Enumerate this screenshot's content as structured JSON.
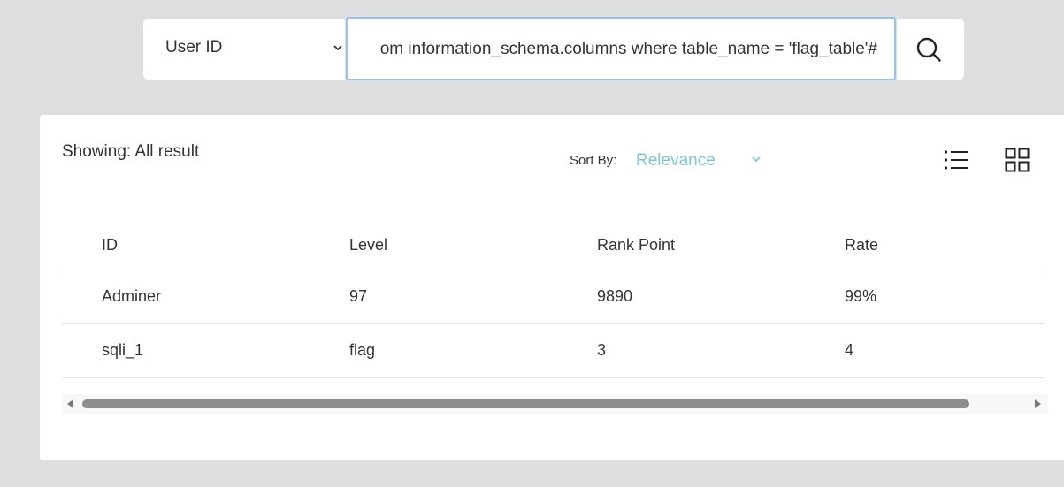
{
  "search": {
    "select_value": "User ID",
    "query_value": "om information_schema.columns where table_name = 'flag_table'#"
  },
  "results": {
    "showing_text": "Showing: All result",
    "sort_label": "Sort By:",
    "sort_value": "Relevance"
  },
  "table": {
    "headers": [
      "ID",
      "Level",
      "Rank Point",
      "Rate"
    ],
    "rows": [
      [
        "Adminer",
        "97",
        "9890",
        "99%"
      ],
      [
        "sqli_1",
        "flag",
        "3",
        "4"
      ]
    ]
  },
  "colors": {
    "accent": "#7ec7cd",
    "input_focus_border": "#9cc3e6",
    "background": "#dedede"
  },
  "icons": [
    "chevron-down-icon",
    "search-icon",
    "list-view-icon",
    "grid-view-icon"
  ]
}
